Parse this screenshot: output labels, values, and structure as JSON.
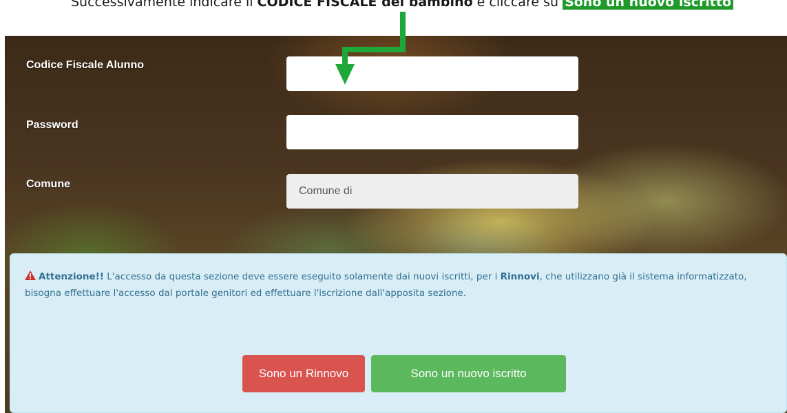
{
  "instruction": {
    "pre": "Successivamente indicare il ",
    "bold": "CODICE FISCALE del bambino",
    "mid": " e cliccare su ",
    "highlight": "Sono un nuovo iscritto"
  },
  "form": {
    "fields": [
      {
        "label": "Codice Fiscale Alunno",
        "value": ""
      },
      {
        "label": "Password",
        "value": ""
      },
      {
        "label": "Comune",
        "value": "Comune di"
      }
    ]
  },
  "alert": {
    "title": "Attenzione!!",
    "text_1": " L'accesso da questa sezione deve essere eseguito solamente dai nuovi iscritti, per i ",
    "bold_word": "Rinnovi",
    "text_2": ", che utilizzano già il sistema informatizzato, bisogna effettuare l'accesso dal portale genitori ed effettuare l'iscrizione dall'apposita sezione."
  },
  "buttons": {
    "renewal": "Sono un Rinnovo",
    "new": "Sono un nuovo iscritto"
  },
  "colors": {
    "arrow": "#1fa83a",
    "alert_bg": "#d9edf7",
    "alert_text": "#31708f",
    "button_red": "#d9534f",
    "button_green": "#5cb85c",
    "warning_icon": "#c9302c"
  },
  "icons": {
    "warning": "warning-triangle-icon",
    "annotation": "annotation-arrow-icon"
  }
}
